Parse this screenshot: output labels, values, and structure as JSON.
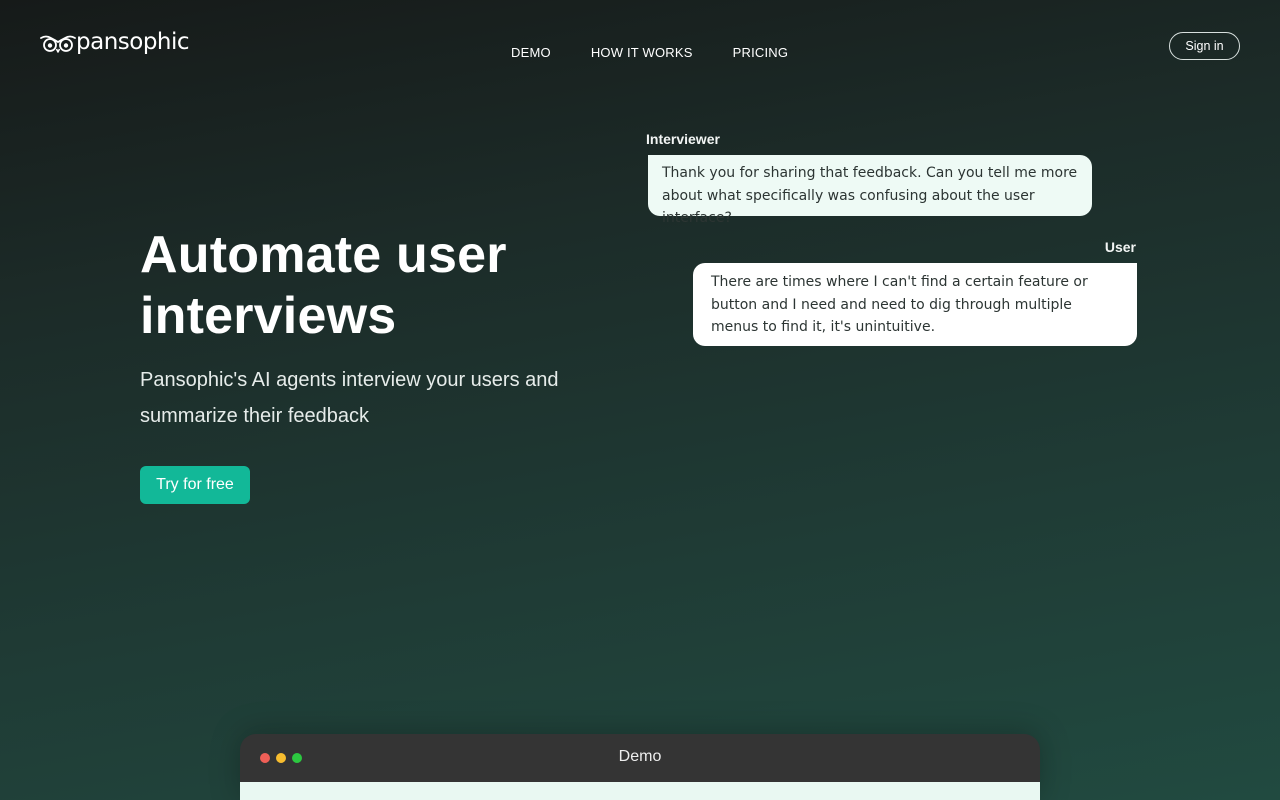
{
  "brand": {
    "name": "pansophic",
    "icon": "owl-eyes-icon"
  },
  "nav": {
    "items": [
      {
        "label": "DEMO"
      },
      {
        "label": "HOW IT WORKS"
      },
      {
        "label": "PRICING"
      }
    ],
    "signin_label": "Sign in"
  },
  "hero": {
    "title": "Automate user interviews",
    "subtitle": "Pansophic's AI agents interview your users and summarize their feedback",
    "cta_label": "Try for free"
  },
  "chat": {
    "interviewer": {
      "label": "Interviewer",
      "message": "Thank you for sharing that feedback. Can you tell me more about what specifically was confusing about the user interface?"
    },
    "user": {
      "label": "User",
      "message": "There are times where I can't find a certain feature or button and I need and need to dig through multiple menus to find it, it's unintuitive."
    }
  },
  "demo_window": {
    "title": "Demo"
  },
  "colors": {
    "accent": "#12b898",
    "background_dark": "#161a19",
    "background_green": "#214a40",
    "interviewer_bubble": "#eefaf5",
    "user_bubble": "#ffffff",
    "window_bar": "#343434"
  }
}
